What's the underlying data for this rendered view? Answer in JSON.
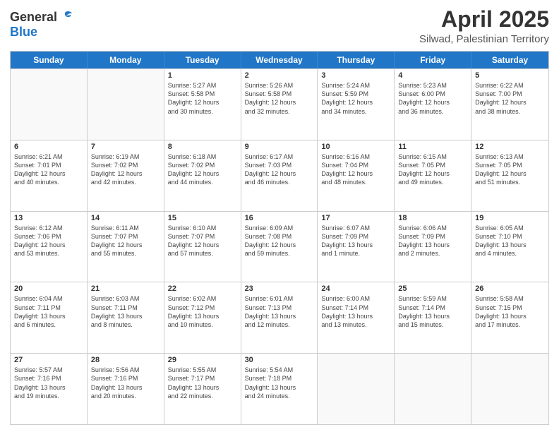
{
  "header": {
    "logo_line1": "General",
    "logo_line2": "Blue",
    "month": "April 2025",
    "location": "Silwad, Palestinian Territory"
  },
  "weekdays": [
    "Sunday",
    "Monday",
    "Tuesday",
    "Wednesday",
    "Thursday",
    "Friday",
    "Saturday"
  ],
  "rows": [
    [
      {
        "day": "",
        "lines": []
      },
      {
        "day": "",
        "lines": []
      },
      {
        "day": "1",
        "lines": [
          "Sunrise: 5:27 AM",
          "Sunset: 5:58 PM",
          "Daylight: 12 hours",
          "and 30 minutes."
        ]
      },
      {
        "day": "2",
        "lines": [
          "Sunrise: 5:26 AM",
          "Sunset: 5:58 PM",
          "Daylight: 12 hours",
          "and 32 minutes."
        ]
      },
      {
        "day": "3",
        "lines": [
          "Sunrise: 5:24 AM",
          "Sunset: 5:59 PM",
          "Daylight: 12 hours",
          "and 34 minutes."
        ]
      },
      {
        "day": "4",
        "lines": [
          "Sunrise: 5:23 AM",
          "Sunset: 6:00 PM",
          "Daylight: 12 hours",
          "and 36 minutes."
        ]
      },
      {
        "day": "5",
        "lines": [
          "Sunrise: 6:22 AM",
          "Sunset: 7:00 PM",
          "Daylight: 12 hours",
          "and 38 minutes."
        ]
      }
    ],
    [
      {
        "day": "6",
        "lines": [
          "Sunrise: 6:21 AM",
          "Sunset: 7:01 PM",
          "Daylight: 12 hours",
          "and 40 minutes."
        ]
      },
      {
        "day": "7",
        "lines": [
          "Sunrise: 6:19 AM",
          "Sunset: 7:02 PM",
          "Daylight: 12 hours",
          "and 42 minutes."
        ]
      },
      {
        "day": "8",
        "lines": [
          "Sunrise: 6:18 AM",
          "Sunset: 7:02 PM",
          "Daylight: 12 hours",
          "and 44 minutes."
        ]
      },
      {
        "day": "9",
        "lines": [
          "Sunrise: 6:17 AM",
          "Sunset: 7:03 PM",
          "Daylight: 12 hours",
          "and 46 minutes."
        ]
      },
      {
        "day": "10",
        "lines": [
          "Sunrise: 6:16 AM",
          "Sunset: 7:04 PM",
          "Daylight: 12 hours",
          "and 48 minutes."
        ]
      },
      {
        "day": "11",
        "lines": [
          "Sunrise: 6:15 AM",
          "Sunset: 7:05 PM",
          "Daylight: 12 hours",
          "and 49 minutes."
        ]
      },
      {
        "day": "12",
        "lines": [
          "Sunrise: 6:13 AM",
          "Sunset: 7:05 PM",
          "Daylight: 12 hours",
          "and 51 minutes."
        ]
      }
    ],
    [
      {
        "day": "13",
        "lines": [
          "Sunrise: 6:12 AM",
          "Sunset: 7:06 PM",
          "Daylight: 12 hours",
          "and 53 minutes."
        ]
      },
      {
        "day": "14",
        "lines": [
          "Sunrise: 6:11 AM",
          "Sunset: 7:07 PM",
          "Daylight: 12 hours",
          "and 55 minutes."
        ]
      },
      {
        "day": "15",
        "lines": [
          "Sunrise: 6:10 AM",
          "Sunset: 7:07 PM",
          "Daylight: 12 hours",
          "and 57 minutes."
        ]
      },
      {
        "day": "16",
        "lines": [
          "Sunrise: 6:09 AM",
          "Sunset: 7:08 PM",
          "Daylight: 12 hours",
          "and 59 minutes."
        ]
      },
      {
        "day": "17",
        "lines": [
          "Sunrise: 6:07 AM",
          "Sunset: 7:09 PM",
          "Daylight: 13 hours",
          "and 1 minute."
        ]
      },
      {
        "day": "18",
        "lines": [
          "Sunrise: 6:06 AM",
          "Sunset: 7:09 PM",
          "Daylight: 13 hours",
          "and 2 minutes."
        ]
      },
      {
        "day": "19",
        "lines": [
          "Sunrise: 6:05 AM",
          "Sunset: 7:10 PM",
          "Daylight: 13 hours",
          "and 4 minutes."
        ]
      }
    ],
    [
      {
        "day": "20",
        "lines": [
          "Sunrise: 6:04 AM",
          "Sunset: 7:11 PM",
          "Daylight: 13 hours",
          "and 6 minutes."
        ]
      },
      {
        "day": "21",
        "lines": [
          "Sunrise: 6:03 AM",
          "Sunset: 7:11 PM",
          "Daylight: 13 hours",
          "and 8 minutes."
        ]
      },
      {
        "day": "22",
        "lines": [
          "Sunrise: 6:02 AM",
          "Sunset: 7:12 PM",
          "Daylight: 13 hours",
          "and 10 minutes."
        ]
      },
      {
        "day": "23",
        "lines": [
          "Sunrise: 6:01 AM",
          "Sunset: 7:13 PM",
          "Daylight: 13 hours",
          "and 12 minutes."
        ]
      },
      {
        "day": "24",
        "lines": [
          "Sunrise: 6:00 AM",
          "Sunset: 7:14 PM",
          "Daylight: 13 hours",
          "and 13 minutes."
        ]
      },
      {
        "day": "25",
        "lines": [
          "Sunrise: 5:59 AM",
          "Sunset: 7:14 PM",
          "Daylight: 13 hours",
          "and 15 minutes."
        ]
      },
      {
        "day": "26",
        "lines": [
          "Sunrise: 5:58 AM",
          "Sunset: 7:15 PM",
          "Daylight: 13 hours",
          "and 17 minutes."
        ]
      }
    ],
    [
      {
        "day": "27",
        "lines": [
          "Sunrise: 5:57 AM",
          "Sunset: 7:16 PM",
          "Daylight: 13 hours",
          "and 19 minutes."
        ]
      },
      {
        "day": "28",
        "lines": [
          "Sunrise: 5:56 AM",
          "Sunset: 7:16 PM",
          "Daylight: 13 hours",
          "and 20 minutes."
        ]
      },
      {
        "day": "29",
        "lines": [
          "Sunrise: 5:55 AM",
          "Sunset: 7:17 PM",
          "Daylight: 13 hours",
          "and 22 minutes."
        ]
      },
      {
        "day": "30",
        "lines": [
          "Sunrise: 5:54 AM",
          "Sunset: 7:18 PM",
          "Daylight: 13 hours",
          "and 24 minutes."
        ]
      },
      {
        "day": "",
        "lines": []
      },
      {
        "day": "",
        "lines": []
      },
      {
        "day": "",
        "lines": []
      }
    ]
  ]
}
